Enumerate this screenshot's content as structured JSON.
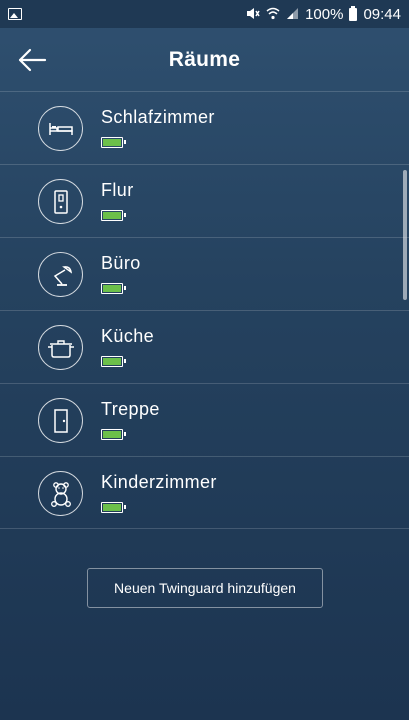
{
  "status_bar": {
    "battery_percent": "100%",
    "time": "09:44",
    "icons": [
      "gallery-icon",
      "mute-icon",
      "wifi-icon",
      "signal-icon",
      "battery-icon"
    ]
  },
  "header": {
    "title": "Räume",
    "back_icon": "arrow-left-icon"
  },
  "rooms": [
    {
      "name": "Schlafzimmer",
      "icon": "bed-icon",
      "battery_level": 1.0
    },
    {
      "name": "Flur",
      "icon": "switch-icon",
      "battery_level": 1.0
    },
    {
      "name": "Büro",
      "icon": "desk-lamp-icon",
      "battery_level": 1.0
    },
    {
      "name": "Küche",
      "icon": "cooking-pot-icon",
      "battery_level": 1.0
    },
    {
      "name": "Treppe",
      "icon": "door-icon",
      "battery_level": 1.0
    },
    {
      "name": "Kinderzimmer",
      "icon": "teddy-bear-icon",
      "battery_level": 1.0
    }
  ],
  "add_button": {
    "label": "Neuen Twinguard hinzufügen"
  },
  "colors": {
    "background": "#25425f",
    "battery_fill": "#6cc04a"
  }
}
